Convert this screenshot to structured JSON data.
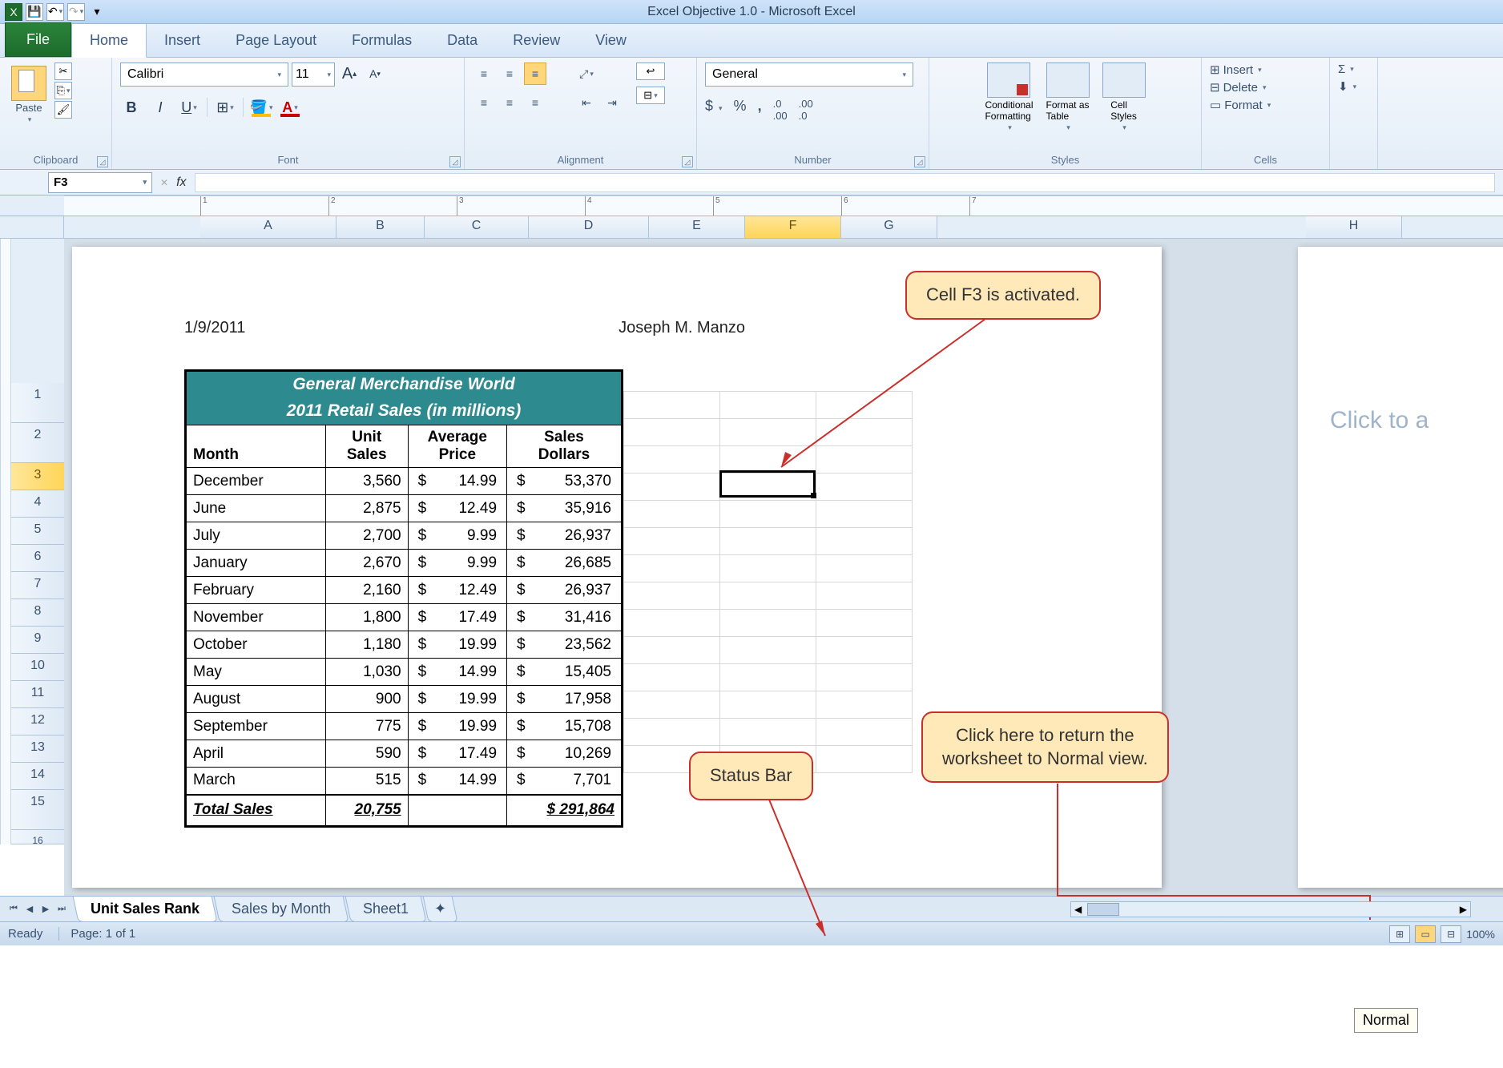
{
  "titlebar": {
    "title": "Excel Objective 1.0 - Microsoft Excel"
  },
  "tabs": {
    "file": "File",
    "items": [
      "Home",
      "Insert",
      "Page Layout",
      "Formulas",
      "Data",
      "Review",
      "View"
    ],
    "active": "Home"
  },
  "ribbon": {
    "clipboard": {
      "label": "Clipboard",
      "paste": "Paste"
    },
    "font": {
      "label": "Font",
      "name": "Calibri",
      "size": "11"
    },
    "alignment": {
      "label": "Alignment"
    },
    "number": {
      "label": "Number",
      "format": "General"
    },
    "styles": {
      "label": "Styles",
      "conditional": "Conditional\nFormatting",
      "formatAs": "Format as\nTable",
      "cellStyles": "Cell\nStyles"
    },
    "cells": {
      "label": "Cells",
      "insert": "Insert",
      "delete": "Delete",
      "format": "Format"
    }
  },
  "formulaBar": {
    "nameBox": "F3",
    "fx": "fx"
  },
  "columns": [
    "A",
    "B",
    "C",
    "D",
    "E",
    "F",
    "G",
    "H"
  ],
  "activeCol": "F",
  "activeRow": 3,
  "pageHeader": {
    "date": "1/9/2011",
    "author": "Joseph M. Manzo"
  },
  "page2Text": "Click to a",
  "table": {
    "title1": "General Merchandise World",
    "title2": "2011 Retail Sales (in millions)",
    "headers": [
      "Month",
      "Unit\nSales",
      "Average\nPrice",
      "Sales\nDollars"
    ],
    "rows": [
      {
        "month": "December",
        "units": "3,560",
        "price": "14.99",
        "sales": "53,370"
      },
      {
        "month": "June",
        "units": "2,875",
        "price": "12.49",
        "sales": "35,916"
      },
      {
        "month": "July",
        "units": "2,700",
        "price": "9.99",
        "sales": "26,937"
      },
      {
        "month": "January",
        "units": "2,670",
        "price": "9.99",
        "sales": "26,685"
      },
      {
        "month": "February",
        "units": "2,160",
        "price": "12.49",
        "sales": "26,937"
      },
      {
        "month": "November",
        "units": "1,800",
        "price": "17.49",
        "sales": "31,416"
      },
      {
        "month": "October",
        "units": "1,180",
        "price": "19.99",
        "sales": "23,562"
      },
      {
        "month": "May",
        "units": "1,030",
        "price": "14.99",
        "sales": "15,405"
      },
      {
        "month": "August",
        "units": "900",
        "price": "19.99",
        "sales": "17,958"
      },
      {
        "month": "September",
        "units": "775",
        "price": "19.99",
        "sales": "15,708"
      },
      {
        "month": "April",
        "units": "590",
        "price": "17.49",
        "sales": "10,269"
      },
      {
        "month": "March",
        "units": "515",
        "price": "14.99",
        "sales": "7,701"
      }
    ],
    "totalLabel": "Total Sales",
    "totalUnits": "20,755",
    "totalSales": "$  291,864"
  },
  "callouts": {
    "activeCell": "Cell F3 is activated.",
    "statusBar": "Status Bar",
    "normalView": "Click here to return the\nworksheet to Normal view."
  },
  "sheetTabs": {
    "tabs": [
      "Unit Sales Rank",
      "Sales by Month",
      "Sheet1"
    ],
    "active": "Unit Sales Rank"
  },
  "statusBar": {
    "ready": "Ready",
    "page": "Page: 1 of 1",
    "normalTooltip": "Normal",
    "zoom": "100%"
  }
}
